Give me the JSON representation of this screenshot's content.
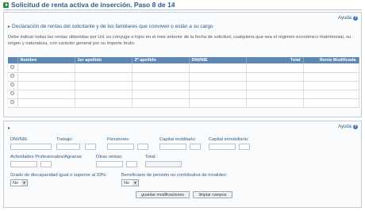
{
  "header": {
    "title": "Solicitud de renta activa de inserción. Paso 8 de 14"
  },
  "help": {
    "label": "Ayuda",
    "glyph": "?"
  },
  "section1": {
    "heading": "Declaración de rentas del solicitante y de los familiares que conviven o están a su cargo",
    "description": "Debe indicar todas las rentas obtenidas por Ud. su cónyuge e hijos en el mes anterior de la fecha de solicitud, cualquiera que sea el régimen económico matrimonial, su origen y naturaleza, con carácter general por su importe bruto.",
    "table": {
      "columns": [
        "Nombre",
        "1er apellido",
        "2º apellido",
        "DNI/NIE",
        "Total",
        "Renta Modificada"
      ],
      "rows": 5
    }
  },
  "form": {
    "labels": {
      "dni": "DNI/NIE:",
      "trabajo": "Trabajo:",
      "pensiones": "Pensiones:",
      "capital_mobiliario": "Capital mobiliario:",
      "capital_inmobiliario": "Capital inmobiliario:",
      "actividades": "Actividades Profesionales/Agrarias:",
      "otras_rentas": "Otras rentas:",
      "total": "Total:",
      "discapacidad": "Grado de discapacidad igual o superior al 33%:",
      "beneficiario": "Beneficiario de pensión no contributiva de invalidez:"
    },
    "discapacidad_value": "No",
    "beneficiario_value": "No",
    "buttons": {
      "save": "guardar modificaciones",
      "clear": "limpiar campos"
    }
  },
  "colors": {
    "accent": "#2a5d8a",
    "table_header": "#5e88b0",
    "icon_green": "#2d8a3e"
  }
}
